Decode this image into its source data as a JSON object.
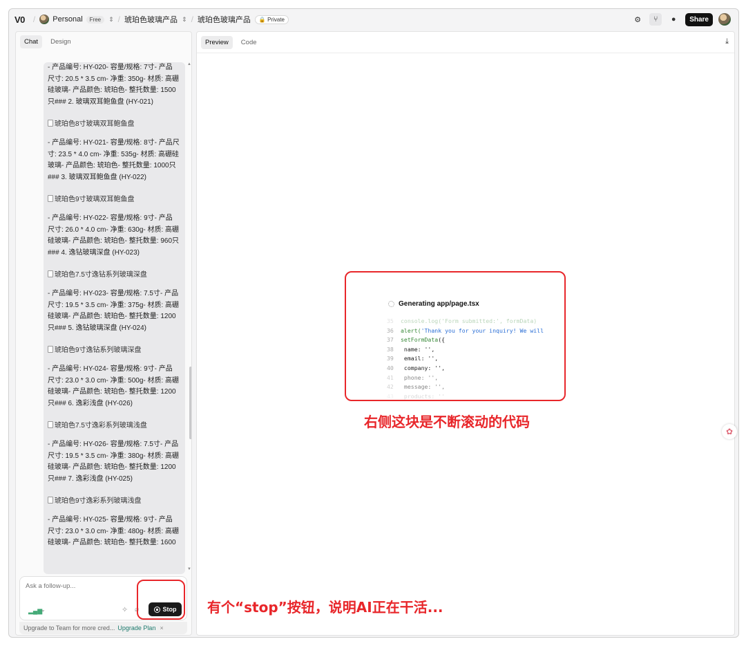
{
  "topbar": {
    "logo": "V0",
    "workspace": "Personal",
    "plan_badge": "Free",
    "project": "琥珀色玻璃产品",
    "chat_title": "琥珀色玻璃产品",
    "visibility_badge": "Private",
    "share_label": "Share",
    "icons": [
      "gear-icon",
      "fork-icon",
      "github-icon"
    ]
  },
  "left_tabs": [
    {
      "label": "Chat"
    },
    {
      "label": "Design"
    }
  ],
  "right_tabs": [
    {
      "label": "Preview"
    },
    {
      "label": "Code"
    }
  ],
  "chat": {
    "blocks": [
      {
        "type": "text",
        "lines": [
          "- 产品编号: HY-020- 容量/规格: 7寸- 产品",
          "尺寸: 20.5 * 3.5 cm- 净重: 350g- 材质: 高硼",
          "硅玻璃- 产品颜色: 琥珀色- 整托数量: 1500",
          "只### 2. 玻璃双耳鲍鱼盘 (HY-021)"
        ]
      },
      {
        "type": "img",
        "alt": "琥珀色8寸玻璃双耳鲍鱼盘"
      },
      {
        "type": "text",
        "lines": [
          "- 产品编号: HY-021- 容量/规格: 8寸- 产品尺",
          "寸: 23.5 * 4.0 cm- 净重: 535g- 材质: 高硼硅",
          "玻璃- 产品颜色: 琥珀色- 整托数量: 1000只",
          "### 3. 玻璃双耳鲍鱼盘 (HY-022)"
        ]
      },
      {
        "type": "img",
        "alt": "琥珀色9寸玻璃双耳鲍鱼盘"
      },
      {
        "type": "text",
        "lines": [
          "- 产品编号: HY-022- 容量/规格: 9寸- 产品",
          "尺寸: 26.0 * 4.0 cm- 净重: 630g- 材质: 高硼",
          "硅玻璃- 产品颜色: 琥珀色- 整托数量: 960只",
          "### 4. 逸钻玻璃深盘 (HY-023)"
        ]
      },
      {
        "type": "img",
        "alt": "琥珀色7.5寸逸钻系列玻璃深盘"
      },
      {
        "type": "text",
        "lines": [
          "- 产品编号: HY-023- 容量/规格: 7.5寸- 产品",
          "尺寸: 19.5 * 3.5 cm- 净重: 375g- 材质: 高硼",
          "硅玻璃- 产品颜色: 琥珀色- 整托数量: 1200",
          "只### 5. 逸钻玻璃深盘 (HY-024)"
        ]
      },
      {
        "type": "img",
        "alt": "琥珀色9寸逸钻系列玻璃深盘"
      },
      {
        "type": "text",
        "lines": [
          "- 产品编号: HY-024- 容量/规格: 9寸- 产品",
          "尺寸: 23.0 * 3.0 cm- 净重: 500g- 材质: 高硼",
          "硅玻璃- 产品颜色: 琥珀色- 整托数量: 1200",
          "只### 6. 逸彩浅盘 (HY-026)"
        ]
      },
      {
        "type": "img",
        "alt": "琥珀色7.5寸逸彩系列玻璃浅盘"
      },
      {
        "type": "text",
        "lines": [
          "- 产品编号: HY-026- 容量/规格: 7.5寸- 产品",
          "尺寸: 19.5 * 3.5 cm- 净重: 380g- 材质: 高硼",
          "硅玻璃- 产品颜色: 琥珀色- 整托数量: 1200",
          "只### 7. 逸彩浅盘 (HY-025)"
        ]
      },
      {
        "type": "img",
        "alt": "琥珀色9寸逸彩系列玻璃浅盘"
      },
      {
        "type": "text",
        "lines": [
          "- 产品编号: HY-025- 容量/规格: 9寸- 产品",
          "尺寸: 23.0 * 3.0 cm- 净重: 480g- 材质: 高硼",
          "硅玻璃- 产品颜色: 琥珀色- 整托数量: 1600"
        ]
      }
    ]
  },
  "input": {
    "placeholder": "Ask a follow-up...",
    "stop_label": "Stop"
  },
  "upgrade": {
    "text": "Upgrade to Team for more cred...",
    "link": "Upgrade Plan",
    "close": "×"
  },
  "preview": {
    "generating_label": "Generating app/page.tsx",
    "code_lines": [
      {
        "n": "35",
        "parts": [
          {
            "t": "console.log('Form submitted:', formData)",
            "c": "c-fn"
          }
        ],
        "fade": "fade1"
      },
      {
        "n": "36",
        "parts": [
          {
            "t": "alert(",
            "c": "c-fn"
          },
          {
            "t": "'Thank you for your inquiry! We will",
            "c": "c-str"
          }
        ],
        "fade": ""
      },
      {
        "n": "37",
        "parts": [
          {
            "t": "setFormData",
            "c": "c-fn"
          },
          {
            "t": "({",
            "c": "c-txt"
          }
        ],
        "fade": ""
      },
      {
        "n": "38",
        "parts": [
          {
            "t": " name: '',",
            "c": "c-txt"
          }
        ],
        "fade": ""
      },
      {
        "n": "39",
        "parts": [
          {
            "t": " email: '',",
            "c": "c-txt"
          }
        ],
        "fade": ""
      },
      {
        "n": "40",
        "parts": [
          {
            "t": " company: '',",
            "c": "c-txt"
          }
        ],
        "fade": ""
      },
      {
        "n": "41",
        "parts": [
          {
            "t": " phone: '',",
            "c": "c-txt"
          }
        ],
        "fade": "fade2"
      },
      {
        "n": "42",
        "parts": [
          {
            "t": " message: '',",
            "c": "c-txt"
          }
        ],
        "fade": "fade2"
      },
      {
        "n": "43",
        "parts": [
          {
            "t": " products: ''",
            "c": "c-txt"
          }
        ],
        "fade": "fade3"
      }
    ]
  },
  "annotations": {
    "code_note": "右侧这块是不断滚动的代码",
    "stop_note": "有个“stop”按钮，说明AI正在干活...",
    "color": "#e8262a"
  }
}
